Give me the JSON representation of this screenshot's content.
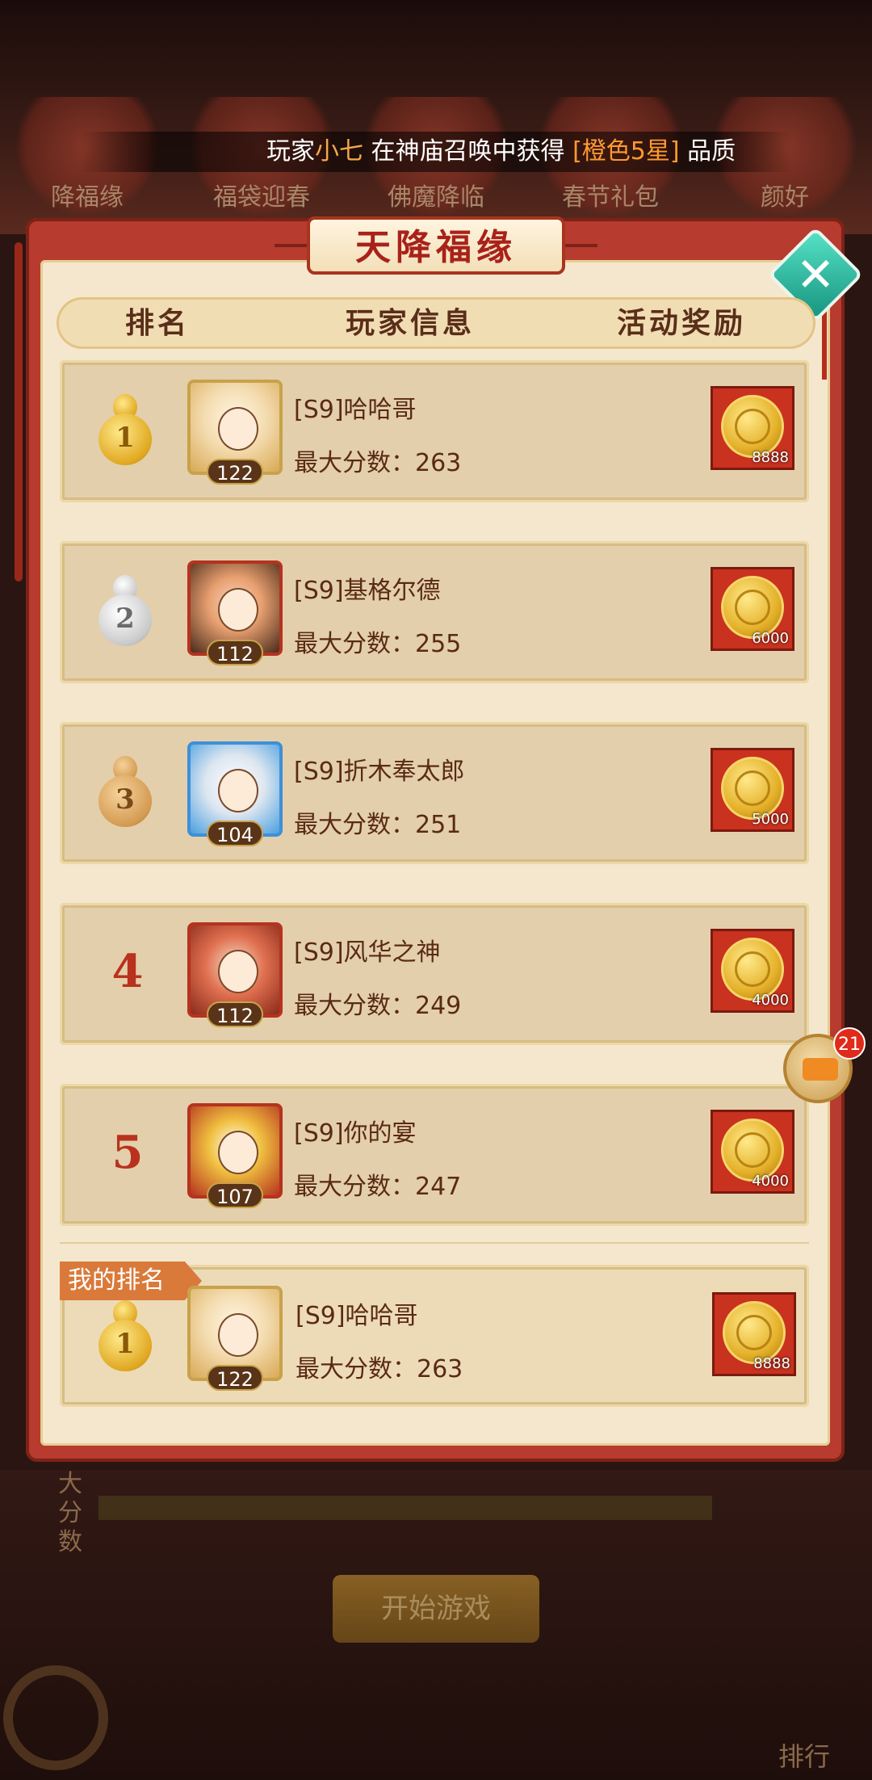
{
  "background": {
    "tabs": [
      "降福缘",
      "福袋迎春",
      "佛魔降临",
      "春节礼包",
      "颜好"
    ],
    "side_label": "大分数",
    "start_button": "开始游戏",
    "rank_button": "排行"
  },
  "marquee": {
    "prefix": "玩家",
    "player": "小七",
    "middle": "在神庙召唤中获得",
    "item": "[橙色5星]",
    "suffix": "品质"
  },
  "panel": {
    "title": "天降福缘",
    "headers": {
      "rank": "排名",
      "player_info": "玩家信息",
      "reward": "活动奖励"
    }
  },
  "score_label": "最大分数：",
  "rows": [
    {
      "rank": "1",
      "medal": "gold",
      "name": "[S9]哈哈哥",
      "level": "122",
      "score": "263",
      "reward_qty": "8888"
    },
    {
      "rank": "2",
      "medal": "silver",
      "name": "[S9]基格尔德",
      "level": "112",
      "score": "255",
      "reward_qty": "6000"
    },
    {
      "rank": "3",
      "medal": "bronze",
      "name": "[S9]折木奉太郎",
      "level": "104",
      "score": "251",
      "reward_qty": "5000"
    },
    {
      "rank": "4",
      "medal": "none",
      "name": "[S9]风华之神",
      "level": "112",
      "score": "249",
      "reward_qty": "4000"
    },
    {
      "rank": "5",
      "medal": "none",
      "name": "[S9]你的宴",
      "level": "107",
      "score": "247",
      "reward_qty": "4000"
    }
  ],
  "my_rank": {
    "tag": "我的排名",
    "rank": "1",
    "name": "[S9]哈哈哥",
    "level": "122",
    "score": "263",
    "reward_qty": "8888"
  },
  "chat": {
    "badge": "21"
  },
  "colors": {
    "panel_red": "#b73b2e",
    "parchment": "#f4e7cd",
    "row_bg": "#e3cfab",
    "text_brown": "#5a2a14",
    "close_green": "#16957e"
  }
}
